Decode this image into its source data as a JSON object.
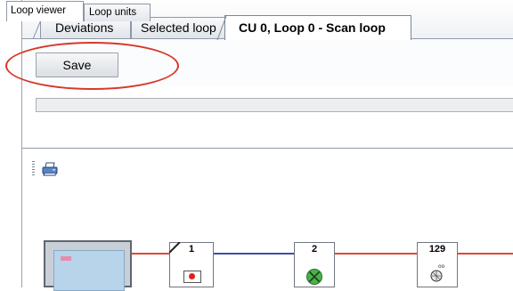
{
  "tabs": [
    {
      "label": "Deviations",
      "active": false
    },
    {
      "label": "Selected loop",
      "active": false
    },
    {
      "label": "CU 0, Loop 0 - Scan loop",
      "active": true
    }
  ],
  "toolbar": {
    "save_label": "Save"
  },
  "subtabs": [
    {
      "label": "Loop viewer",
      "active": true
    },
    {
      "label": "Loop units",
      "active": false
    }
  ],
  "viewer": {
    "icons": [
      "print-icon"
    ],
    "units": [
      {
        "label": "",
        "icon": "control-unit-icon"
      },
      {
        "label": "1",
        "icon": "red-dot-icon"
      },
      {
        "label": "2",
        "icon": "green-cross-icon"
      },
      {
        "label": "129",
        "icon": "sounder-icon"
      }
    ]
  },
  "colors": {
    "highlight": "#d63a2a",
    "loop_red": "#e0483a",
    "loop_blue": "#3f4fa8"
  }
}
